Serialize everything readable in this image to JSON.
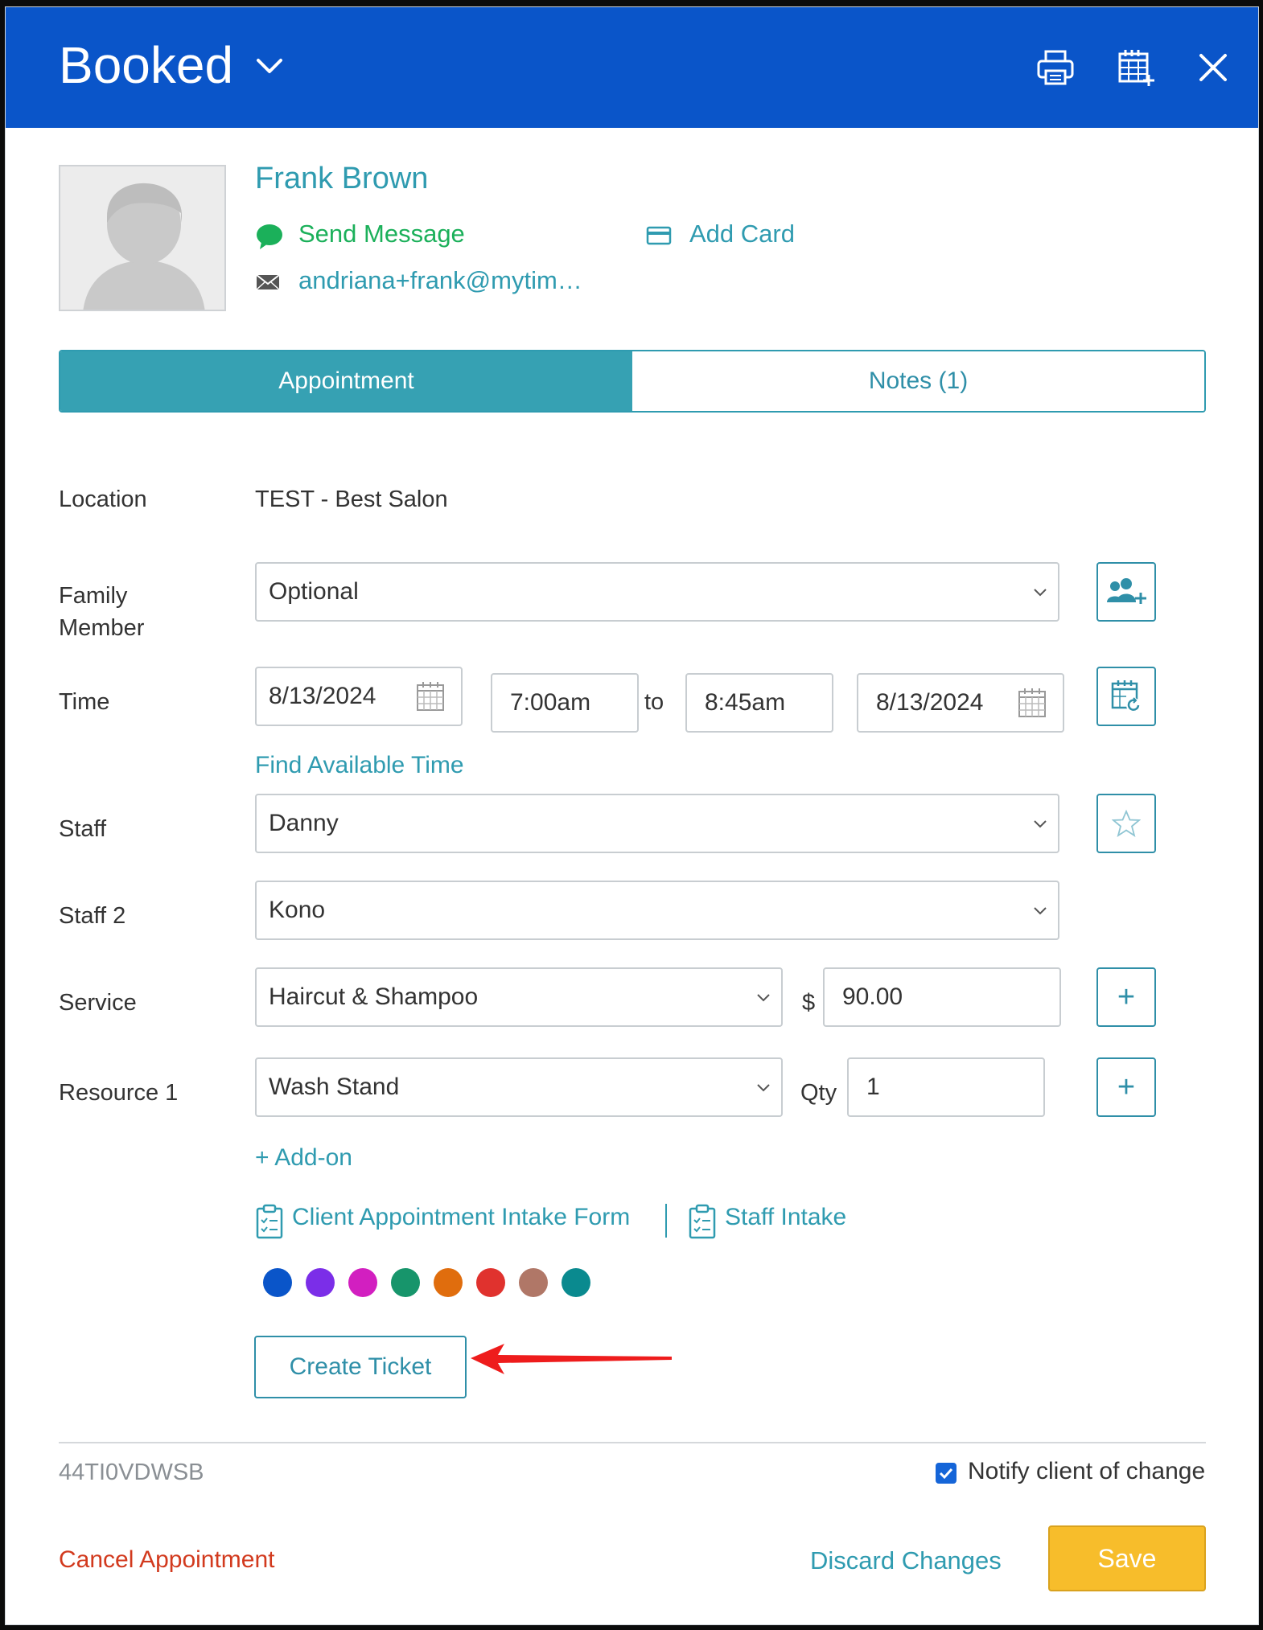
{
  "header": {
    "status": "Booked"
  },
  "client": {
    "name": "Frank Brown",
    "send_message": "Send Message",
    "add_card": "Add Card",
    "email": "andriana+frank@mytim…"
  },
  "tabs": [
    {
      "label": "Appointment",
      "active": true
    },
    {
      "label": "Notes (1)",
      "active": false
    }
  ],
  "form": {
    "location_label": "Location",
    "location_value": "TEST - Best Salon",
    "family_label_1": "Family",
    "family_label_2": "Member",
    "family_value": "Optional",
    "time_label": "Time",
    "start_date": "8/13/2024",
    "start_time": "7:00am",
    "to_label": "to",
    "end_time": "8:45am",
    "end_date": "8/13/2024",
    "find_time": "Find Available Time",
    "staff_label": "Staff",
    "staff_value": "Danny",
    "staff2_label": "Staff 2",
    "staff2_value": "Kono",
    "service_label": "Service",
    "service_value": "Haircut & Shampoo",
    "currency": "$",
    "price": "90.00",
    "resource_label": "Resource 1",
    "resource_value": "Wash Stand",
    "qty_label": "Qty",
    "qty_value": "1",
    "addon": "+ Add-on",
    "intake_form": "Client Appointment Intake Form",
    "staff_intake": "Staff Intake"
  },
  "colors": [
    "#0a55c9",
    "#7b2ee8",
    "#d21fc0",
    "#17956b",
    "#e06d0d",
    "#e0322e",
    "#b07767",
    "#0a8a8f"
  ],
  "actions": {
    "create_ticket": "Create Ticket",
    "booking_code": "44TI0VDWSB",
    "notify_label": "Notify client of change",
    "notify_checked": true,
    "cancel": "Cancel Appointment",
    "discard": "Discard Changes",
    "save": "Save"
  }
}
